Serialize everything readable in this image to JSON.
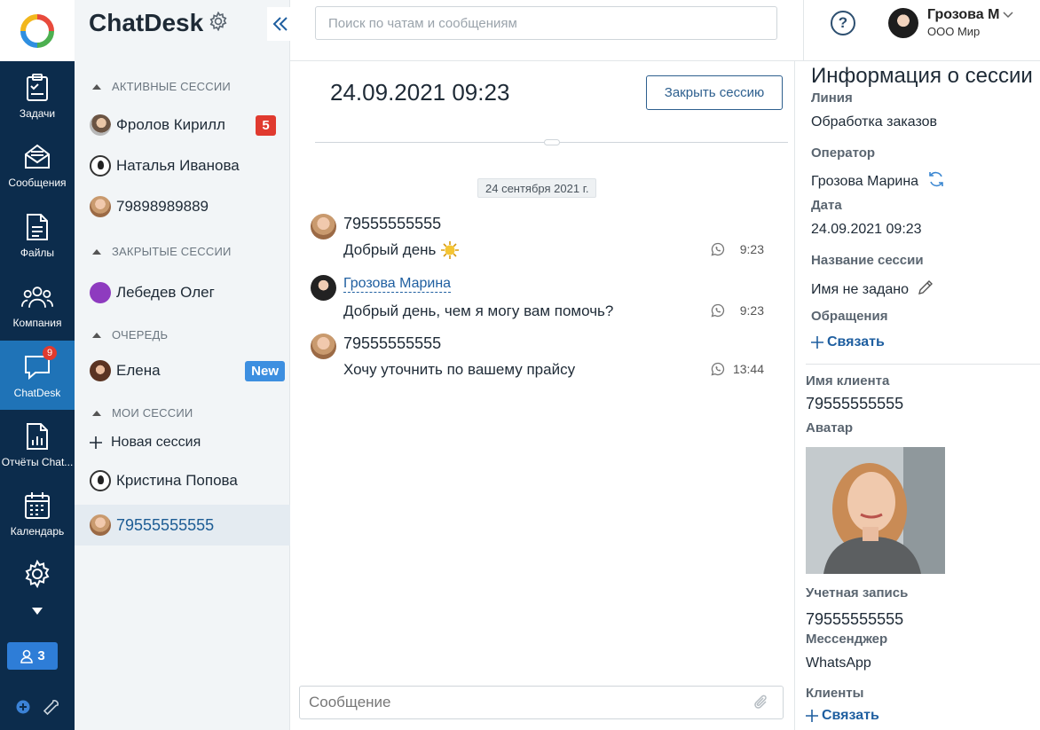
{
  "rail": {
    "items": [
      {
        "key": "tasks",
        "label": "Задачи",
        "icon": "clipboard-icon"
      },
      {
        "key": "messages",
        "label": "Сообщения",
        "icon": "envelope-icon"
      },
      {
        "key": "files",
        "label": "Файлы",
        "icon": "file-icon"
      },
      {
        "key": "company",
        "label": "Компания",
        "icon": "people-icon"
      },
      {
        "key": "chatdesk",
        "label": "ChatDesk",
        "icon": "chat-bubble-icon",
        "badge": "9",
        "active": true
      },
      {
        "key": "reports",
        "label": "Отчёты Chat...",
        "icon": "report-icon"
      },
      {
        "key": "calendar",
        "label": "Календарь",
        "icon": "calendar-icon"
      },
      {
        "key": "settings",
        "label": "",
        "icon": "gear-icon"
      }
    ],
    "online_count": "3"
  },
  "sessions": {
    "brand": "ChatDesk",
    "groups": {
      "active": "АКТИВНЫЕ СЕССИИ",
      "closed": "ЗАКРЫТЫЕ СЕССИИ",
      "queue": "ОЧЕРЕДЬ",
      "mine": "МОИ СЕССИИ"
    },
    "active": [
      {
        "name": "Фролов Кирилл",
        "badge": "5"
      },
      {
        "name": "Наталья Иванова"
      },
      {
        "name": "79898989889"
      }
    ],
    "closed": [
      {
        "name": "Лебедев Олег"
      }
    ],
    "queue": [
      {
        "name": "Елена",
        "badge": "New"
      }
    ],
    "new_session": "Новая сессия",
    "mine": [
      {
        "name": "Кристина Попова"
      },
      {
        "name": "79555555555",
        "selected": true
      }
    ]
  },
  "topbar": {
    "search_placeholder": "Поиск по чатам и сообщениям",
    "user_name": "Грозова М",
    "user_org": "ООО Мир"
  },
  "chat": {
    "title": "24.09.2021 09:23",
    "close_label": "Закрыть сессию",
    "date_chip": "24 сентября 2021 г.",
    "messages": [
      {
        "author": "79555555555",
        "text": "Добрый день",
        "emoji": "sun-emoji",
        "time": "9:23",
        "channel": "whatsapp-icon"
      },
      {
        "author": "Грозова Марина",
        "text": "Добрый день, чем я могу вам помочь?",
        "time": "9:23",
        "channel": "whatsapp-icon",
        "operator": true
      },
      {
        "author": "79555555555",
        "text": "Хочу уточнить по вашему прайсу",
        "time": "13:44",
        "channel": "whatsapp-icon"
      }
    ],
    "composer_placeholder": "Сообщение"
  },
  "info": {
    "title": "Информация о сессии",
    "line_label": "Линия",
    "line_value": "Обработка заказов",
    "operator_label": "Оператор",
    "operator_value": "Грозова Марина",
    "date_label": "Дата",
    "date_value": "24.09.2021 09:23",
    "session_name_label": "Название сессии",
    "session_name_value": "Имя не задано",
    "requests_label": "Обращения",
    "link_label": "Связать",
    "client_name_label": "Имя клиента",
    "client_name_value": "79555555555",
    "avatar_label": "Аватар",
    "account_label": "Учетная запись",
    "account_value": "79555555555",
    "messenger_label": "Мессенджер",
    "messenger_value": "WhatsApp",
    "clients_label": "Клиенты",
    "clients_link": "Связать"
  },
  "colors": {
    "rail_bg": "#0c2c4c",
    "rail_active": "#1f73b7",
    "badge_red": "#e03a2f",
    "link_blue": "#1f5fa0"
  }
}
